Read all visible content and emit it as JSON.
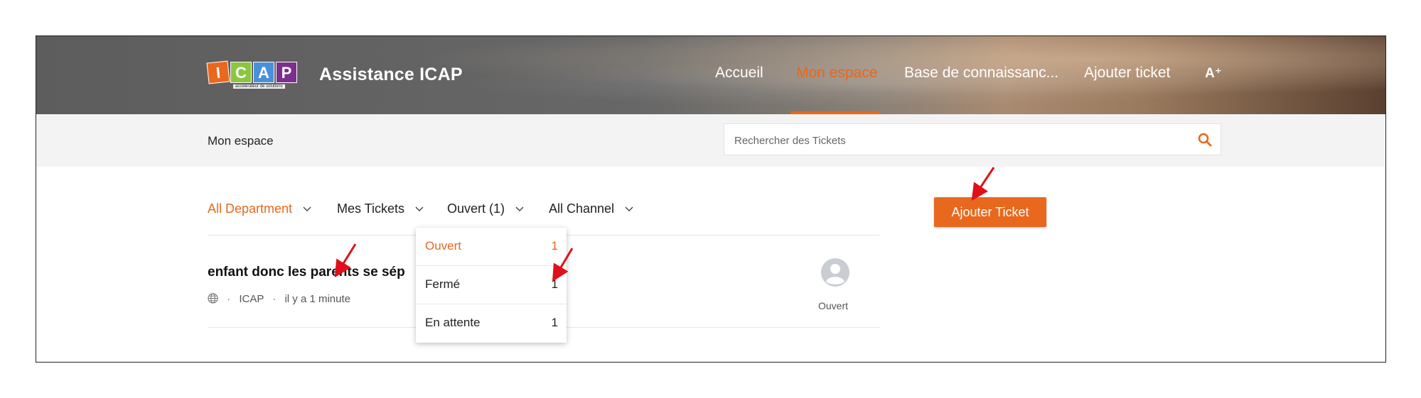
{
  "header": {
    "brand": "Assistance ICAP",
    "logo": {
      "letters": [
        "I",
        "C",
        "A",
        "P"
      ],
      "colors": [
        "#e8681d",
        "#8cc63f",
        "#4a90d9",
        "#7b2f8e"
      ],
      "tagline": "accélérateur de solutions"
    },
    "nav": [
      {
        "label": "Accueil",
        "active": false
      },
      {
        "label": "Mon espace",
        "active": true
      },
      {
        "label": "Base de connaissanc...",
        "active": false
      },
      {
        "label": "Ajouter ticket",
        "active": false
      }
    ],
    "font_size_icon": "A⁺"
  },
  "subbar": {
    "title": "Mon espace",
    "search_placeholder": "Rechercher des Tickets"
  },
  "filters": [
    {
      "label": "All Department",
      "active": true
    },
    {
      "label": "Mes Tickets",
      "active": false
    },
    {
      "label": "Ouvert (1)",
      "active": false
    },
    {
      "label": "All Channel",
      "active": false
    }
  ],
  "add_ticket_label": "Ajouter Ticket",
  "ticket": {
    "title": "enfant donc les parents se sép",
    "channel_icon": "globe-icon",
    "org": "ICAP",
    "time": "il y a 1 minute",
    "status": "Ouvert"
  },
  "status_dropdown": [
    {
      "label": "Ouvert",
      "count": "1",
      "active": true
    },
    {
      "label": "Fermé",
      "count": "1",
      "active": false
    },
    {
      "label": "En attente",
      "count": "1",
      "active": false
    }
  ],
  "colors": {
    "accent": "#e8681d",
    "annotation": "#e0101a"
  }
}
